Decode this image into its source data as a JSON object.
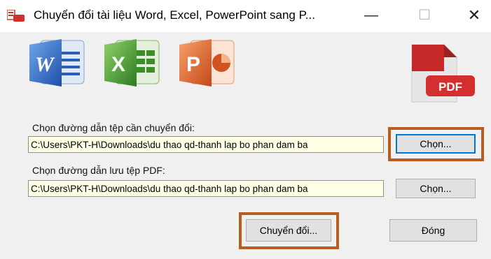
{
  "window": {
    "title": "Chuyển đổi tài liệu Word, Excel, PowerPoint sang P...",
    "minimize_glyph": "—",
    "maximize_glyph": "☐",
    "close_glyph": "✕"
  },
  "icons": {
    "word": "word-document-icon",
    "excel": "excel-document-icon",
    "powerpoint": "powerpoint-document-icon",
    "pdf": "pdf-document-icon",
    "pdf_label": "PDF"
  },
  "source": {
    "label": "Chọn đường dẫn tệp cần chuyển đổi:",
    "value": "C:\\Users\\PKT-H\\Downloads\\du thao qd-thanh lap bo phan dam ba",
    "button": "Chọn..."
  },
  "destination": {
    "label": "Chọn đường dẫn lưu tệp PDF:",
    "value": "C:\\Users\\PKT-H\\Downloads\\du thao qd-thanh lap bo phan dam ba",
    "button": "Chọn..."
  },
  "actions": {
    "convert": "Chuyển đổi...",
    "close": "Đóng"
  },
  "colors": {
    "highlight": "#b85c1f",
    "input_background": "#ffffe6",
    "focus_border": "#0078d7"
  }
}
